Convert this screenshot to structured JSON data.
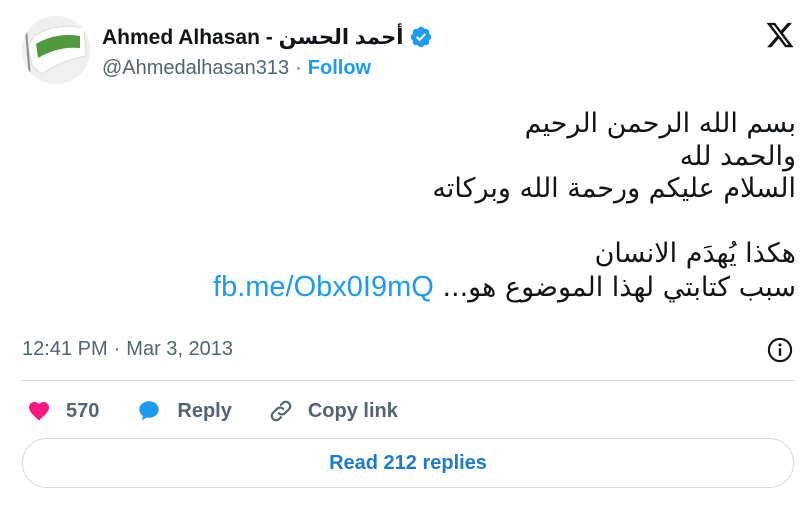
{
  "author": {
    "display_name": "Ahmed Alhasan - أحمد الحسن",
    "handle": "@Ahmedalhasan313",
    "follow_label": "Follow",
    "avatar_text": "البيعة لله"
  },
  "tweet": {
    "lines": [
      "بسم الله الرحمن الرحيم",
      "والحمد لله",
      "السلام عليكم ورحمة الله وبركاته",
      "",
      "هكذا يُهدَم الانسان"
    ],
    "last_line_text": "سبب كتابتي لهذا الموضوع هو...",
    "link_text": "fb.me/Obx0I9mQ"
  },
  "meta": {
    "time": "12:41 PM",
    "separator": "·",
    "date": "Mar 3, 2013"
  },
  "actions": {
    "like_count": "570",
    "reply_label": "Reply",
    "copy_link_label": "Copy link"
  },
  "read_replies_label": "Read 212 replies",
  "colors": {
    "accent": "#1d9bf0",
    "like": "#f91880",
    "text": "#0f1419",
    "secondary": "#536471",
    "border": "#cfd9de"
  }
}
